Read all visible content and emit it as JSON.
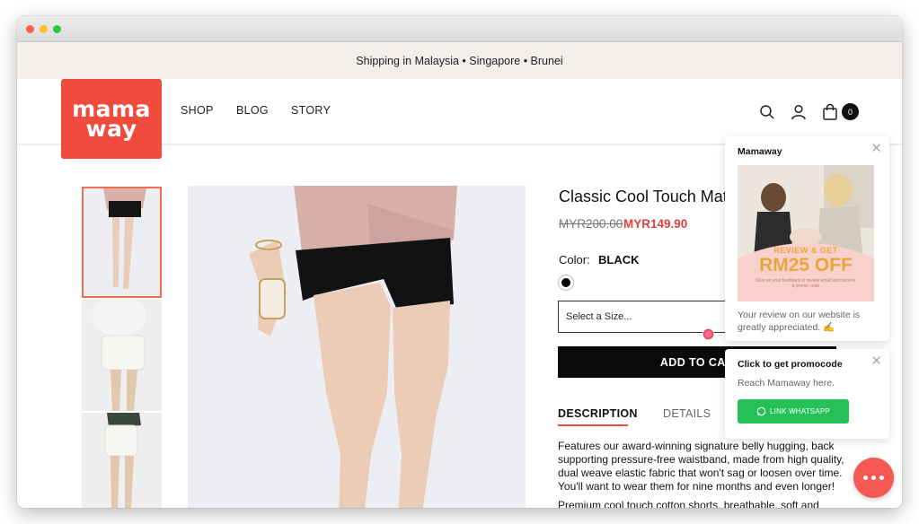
{
  "announcement": "Shipping in Malaysia • Singapore • Brunei",
  "logo": {
    "line1": "mama",
    "line2": "way"
  },
  "nav": [
    "SHOP",
    "BLOG",
    "STORY"
  ],
  "cart": {
    "count": "0"
  },
  "product": {
    "title": "Classic Cool Touch Mate",
    "price_original": "MYR200.00",
    "price_sale": "MYR149.90",
    "color_label": "Color:",
    "color_value": "BLACK",
    "size_placeholder": "Select a Size...",
    "add_to_cart": "ADD TO CAR",
    "tabs": [
      "DESCRIPTION",
      "DETAILS"
    ],
    "description": "Features our award-winning signature belly hugging, back supporting pressure-free waistband, made from high quality, dual weave elastic fabric that won't sag or loosen over time. You'll want to wear them for nine months and even longer!",
    "description2": "Premium cool touch cotton shorts, breathable, soft and"
  },
  "review_popup": {
    "brand": "Mamaway",
    "promo_headline": "REVIEW & GET",
    "promo_amount": "RM25 OFF",
    "promo_small": "Give us your feedback in review email and receive a promo code",
    "text": "Your review on our website is greatly appreciated. ✍"
  },
  "whatsapp_popup": {
    "title": "Click to get promocode",
    "text": "Reach Mamaway here.",
    "button": "LINK WHATSAPP"
  },
  "colors": {
    "brand": "#f04b3c",
    "whatsapp": "#25c158",
    "sale": "#e0403f"
  }
}
